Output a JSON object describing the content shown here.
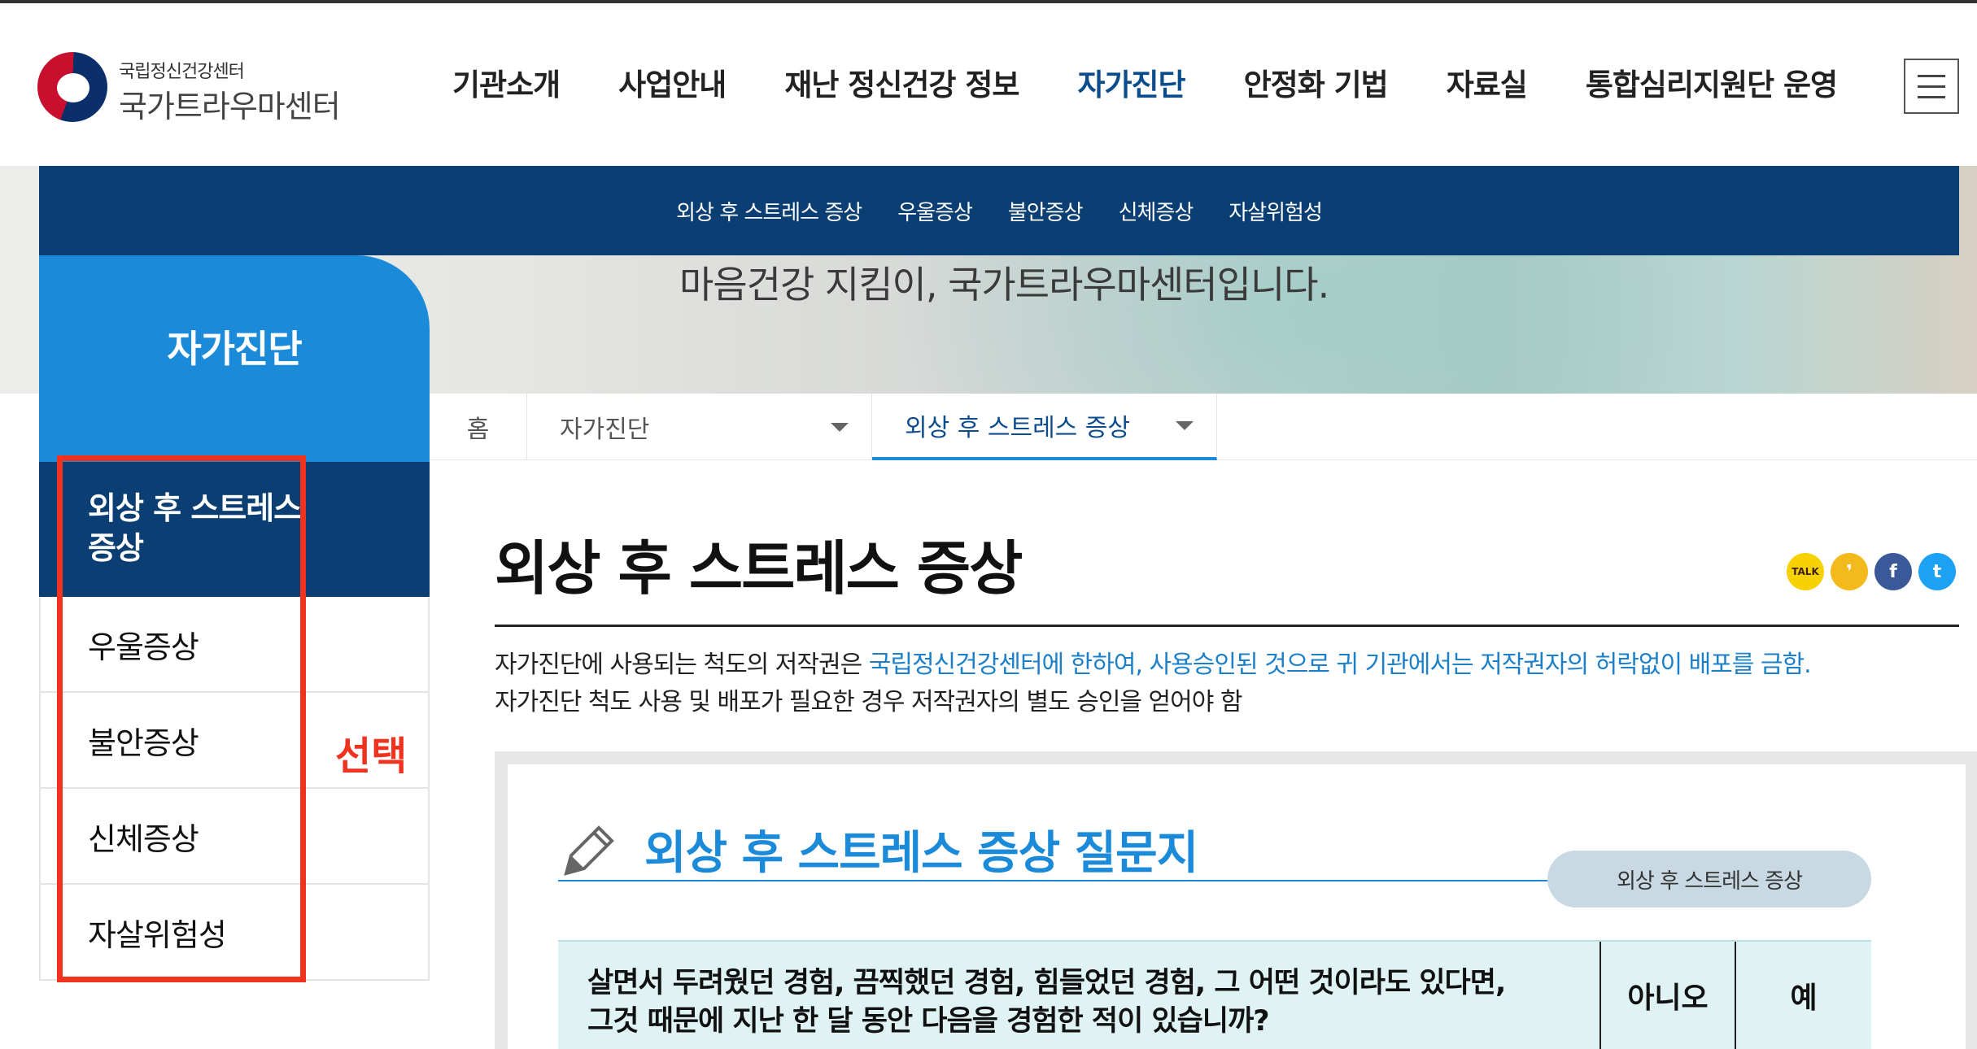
{
  "header": {
    "logo_sub": "국립정신건강센터",
    "logo_main": "국가트라우마센터",
    "nav": [
      "기관소개",
      "사업안내",
      "재난 정신건강 정보",
      "자가진단",
      "안정화 기법",
      "자료실",
      "통합심리지원단 운영"
    ],
    "active_nav": "자가진단",
    "menu_icon": "hamburger-icon"
  },
  "hero": {
    "slogan": "마음건강 지킴이, 국가트라우마센터입니다."
  },
  "sub_nav": [
    "외상 후 스트레스 증상",
    "우울증상",
    "불안증상",
    "신체증상",
    "자살위험성"
  ],
  "sidebar": {
    "title": "자가진단",
    "items": [
      "외상 후 스트레스 증상",
      "우울증상",
      "불안증상",
      "신체증상",
      "자살위험성"
    ],
    "active_index": 0,
    "annotation_label": "선택"
  },
  "breadcrumb": {
    "home": "홈",
    "level1": "자가진단",
    "level2": "외상 후 스트레스 증상"
  },
  "content": {
    "title": "외상 후 스트레스 증상",
    "notice1_plain": "자가진단에 사용되는 척도의 저작권은 ",
    "notice1_highlight": "국립정신건강센터에 한하여, 사용승인된 것으로 귀 기관에서는 저작권자의 허락없이 배포를 금함.",
    "notice2": "자가진단 척도 사용 및 배포가 필요한 경우 저작권자의 별도 승인을 얻어야 함",
    "share_icons": [
      "kakaotalk-icon",
      "kakaostory-icon",
      "facebook-icon",
      "twitter-icon"
    ],
    "share_labels": {
      "kakao": "TALK",
      "story": "❜",
      "fb": "f",
      "tw": "t"
    }
  },
  "quiz": {
    "title": "외상 후 스트레스 증상 질문지",
    "badge": "외상 후 스트레스 증상",
    "question": "살면서 두려웠던 경험, 끔찍했던 경험, 힘들었던 경험, 그 어떤 것이라도 있다면, 그것 때문에 지난 한 달 동안 다음을 경험한 적이 있습니까?",
    "question_line1": "살면서 두려웠던 경험, 끔찍했던 경험, 힘들었던 경험, 그 어떤 것이라도 있다면,",
    "question_line2": "그것 때문에 지난 한 달 동안 다음을 경험한 적이 있습니까?",
    "no_label": "아니오",
    "yes_label": "예"
  },
  "colors": {
    "primary_navy": "#0b3f73",
    "accent_blue": "#1b8ad8",
    "annotation_red": "#f0321e"
  }
}
